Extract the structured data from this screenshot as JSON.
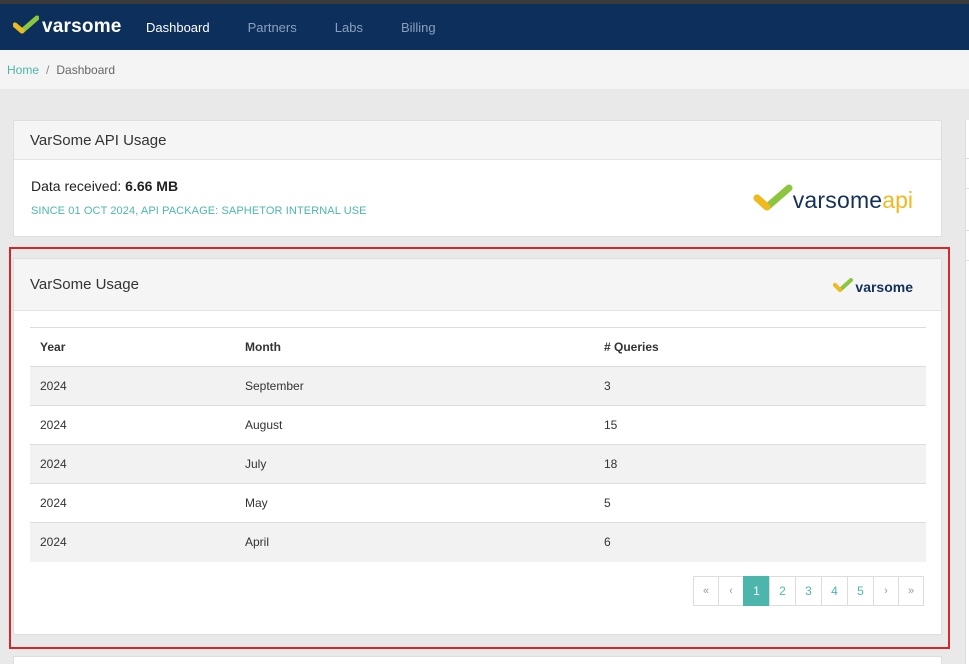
{
  "navbar": {
    "brand": "varsome",
    "items": [
      {
        "label": "Dashboard",
        "active": true
      },
      {
        "label": "Partners",
        "active": false
      },
      {
        "label": "Labs",
        "active": false
      },
      {
        "label": "Billing",
        "active": false
      }
    ]
  },
  "breadcrumb": {
    "home": "Home",
    "separator": "/",
    "current": "Dashboard"
  },
  "api_usage": {
    "title": "VarSome API Usage",
    "data_label": "Data received:",
    "data_value": "6.66 MB",
    "since_text": "SINCE 01 OCT 2024, API PACKAGE: SAPHETOR INTERNAL USE",
    "logo_main": "varsome",
    "logo_suffix": "api"
  },
  "varsome_usage": {
    "title": "VarSome Usage",
    "logo": "varsome",
    "columns": [
      "Year",
      "Month",
      "# Queries"
    ],
    "rows": [
      [
        "2024",
        "September",
        "3"
      ],
      [
        "2024",
        "August",
        "15"
      ],
      [
        "2024",
        "July",
        "18"
      ],
      [
        "2024",
        "May",
        "5"
      ],
      [
        "2024",
        "April",
        "6"
      ]
    ],
    "pagination": {
      "first": "«",
      "prev": "‹",
      "pages": [
        "1",
        "2",
        "3",
        "4",
        "5"
      ],
      "active_page": "1",
      "next": "›",
      "last": "»"
    }
  },
  "colors": {
    "navbar": "#0d2f5c",
    "accent": "#4db6ac",
    "logo_green": "#8cc63f",
    "logo_yellow": "#f2b91e",
    "highlight": "#d62728"
  }
}
